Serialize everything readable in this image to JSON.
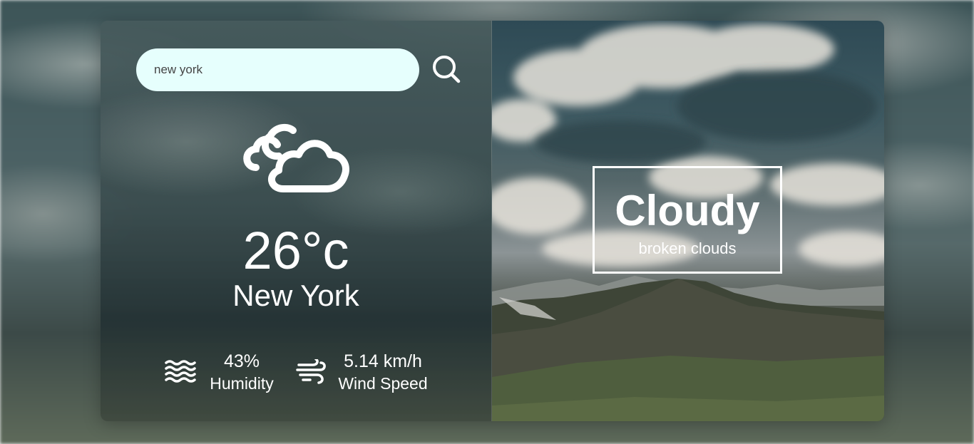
{
  "search": {
    "value": "new york",
    "icon": "search-icon"
  },
  "weather": {
    "icon": "cloudy-icon",
    "temperature": "26°c",
    "city": "New York"
  },
  "stats": {
    "humidity": {
      "icon": "humidity-waves-icon",
      "value": "43%",
      "label": "Humidity"
    },
    "wind": {
      "icon": "wind-icon",
      "value": "5.14 km/h",
      "label": "Wind Speed"
    }
  },
  "condition": {
    "main": "Cloudy",
    "description": "broken clouds"
  },
  "colors": {
    "search_bg": "#e6fffd",
    "text": "#ffffff"
  }
}
